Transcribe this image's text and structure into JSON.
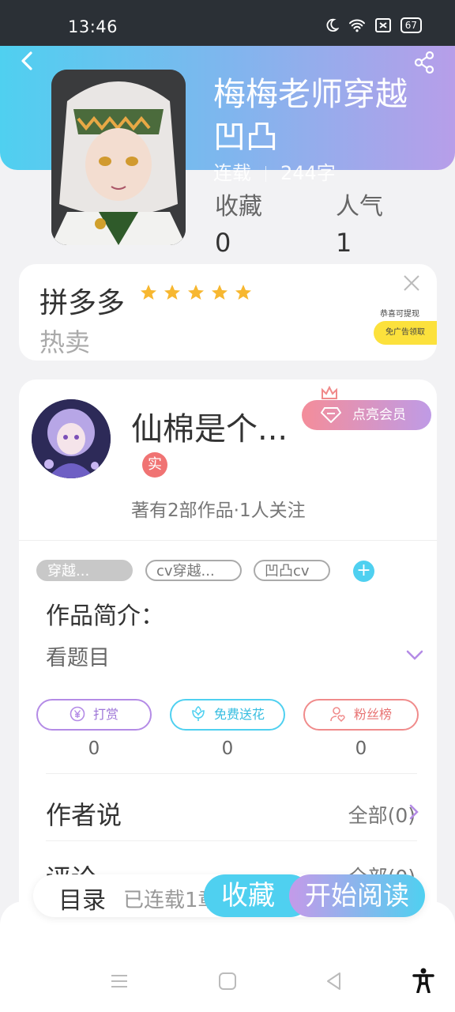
{
  "status_bar": {
    "time": "13:46",
    "battery": "67"
  },
  "book": {
    "title": "梅梅老师穿越凹凸",
    "status": "连载",
    "word_count": "244字",
    "favorites_label": "收藏",
    "favorites_value": "0",
    "popularity_label": "人气",
    "popularity_value": "1"
  },
  "ad": {
    "brand": "拼多多",
    "subtitle": "热卖",
    "mini_text": "恭喜可提现",
    "mini_button": "免广告领取"
  },
  "author": {
    "name": "仙棉是个...",
    "vip_button": "点亮会员",
    "verified_badge": "实",
    "works_text": "著有2部作品·1人关注"
  },
  "tags": [
    "穿越...",
    "cv穿越...",
    "凹凸cv"
  ],
  "intro": {
    "heading": "作品简介：",
    "text": "看题目"
  },
  "actions": [
    {
      "label": "打赏",
      "value": "0",
      "color": "#b48be6"
    },
    {
      "label": "免费送花",
      "value": "0",
      "color": "#4fd0f0"
    },
    {
      "label": "粉丝榜",
      "value": "0",
      "color": "#f08b8b"
    }
  ],
  "author_says": {
    "heading": "作者说",
    "link": "全部(0)"
  },
  "comments": {
    "heading": "评论",
    "link": "全部(0)"
  },
  "bottom_bar": {
    "toc": "目录",
    "serial": "已连载1章",
    "favorite": "收藏",
    "start_reading": "开始阅读"
  }
}
